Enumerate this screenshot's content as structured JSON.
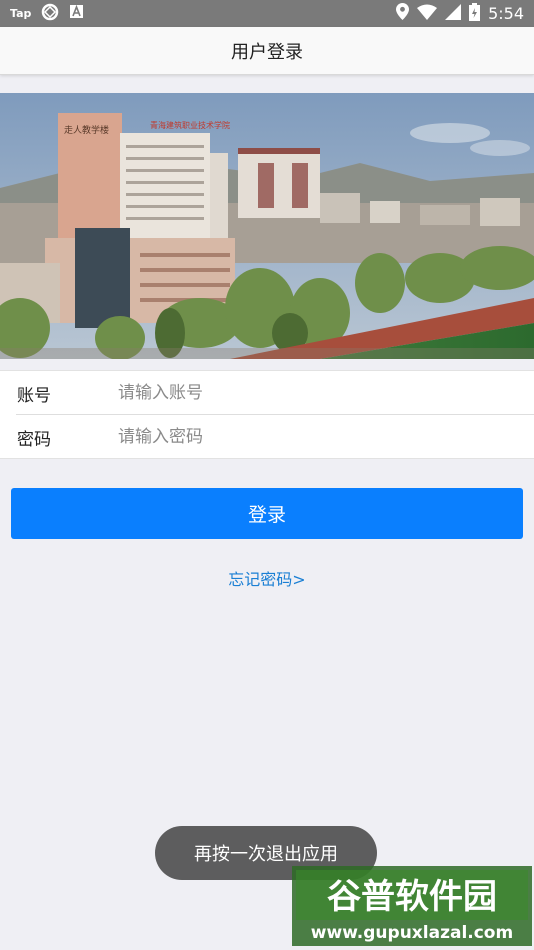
{
  "status_bar": {
    "carrier_badge": "Tap",
    "time": "5:54",
    "icons": [
      "tap-badge",
      "vpn-icon",
      "notification-a-icon",
      "location-icon",
      "wifi-icon",
      "signal-icon",
      "battery-icon"
    ]
  },
  "header": {
    "title": "用户登录"
  },
  "banner": {
    "building_sign": "青海建筑职业技术学院",
    "plaque": "走人教学楼"
  },
  "form": {
    "account_label": "账号",
    "account_placeholder": "请输入账号",
    "password_label": "密码",
    "password_placeholder": "请输入密码"
  },
  "actions": {
    "login_label": "登录",
    "forgot_label": "忘记密码>"
  },
  "toast": {
    "message": "再按一次退出应用"
  },
  "watermark": {
    "brand": "谷普软件园",
    "url": "www.gupuxlazal.com"
  },
  "colors": {
    "primary": "#0a7ffe",
    "link": "#1a7fd4",
    "background": "#efeff4",
    "status_bar": "#7a7a7a"
  }
}
